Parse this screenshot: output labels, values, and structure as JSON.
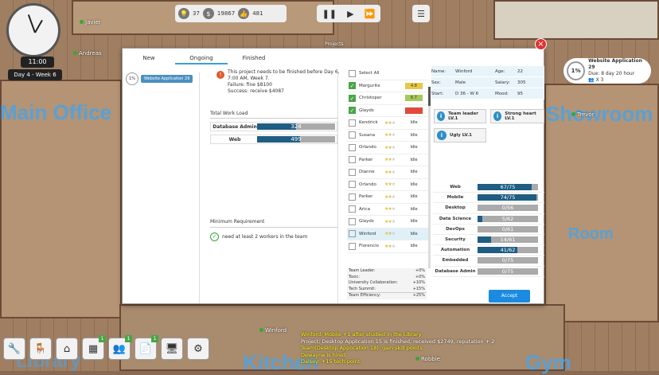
{
  "hud": {
    "time": "11:00",
    "day": "Day 4 - Week 6",
    "ideas": "37",
    "money": "19867",
    "reputation": "481",
    "projects_label": "Projects"
  },
  "rooms": {
    "main_office": "Main Office",
    "kitchen": "Kitchen",
    "gym": "Gym",
    "library": "Library",
    "showroom": "Showroom",
    "other_room": "Room"
  },
  "characters": [
    "Javier",
    "Andreas",
    "Winford",
    "Trevor",
    "Robbie",
    "Florencio"
  ],
  "dialog": {
    "tabs": [
      "New",
      "Ongoing",
      "Finished"
    ],
    "active_tab": "Ongoing",
    "project": {
      "pct": "1%",
      "name": "Website Application 29"
    },
    "info_lines": [
      "This project needs to be finished before Day 6,",
      "7:00 AM, Week 7.",
      "Failure: fine $8100",
      "Success: receive $4087"
    ],
    "workload_title": "Total Work Load",
    "workload": [
      {
        "label": "Database Admin",
        "value": "324",
        "frac": 0.7
      },
      {
        "label": "Web",
        "value": "499",
        "frac": 0.55
      }
    ],
    "min_req_title": "Minimum Requirement",
    "min_req": "need at least 2 workers in the team",
    "select_all": "Select All",
    "workers": [
      {
        "name": "Margurite",
        "checked": true,
        "stars": 0,
        "status": "4.8",
        "status_color": "#e8c84a"
      },
      {
        "name": "Christoper",
        "checked": true,
        "stars": 0,
        "status": "6.7",
        "status_color": "#a8c85a"
      },
      {
        "name": "Glayds",
        "checked": true,
        "stars": 0,
        "status": "",
        "status_color": "#e04a3a"
      },
      {
        "name": "Kendrick",
        "checked": false,
        "stars": 2,
        "status": "Idle",
        "status_color": ""
      },
      {
        "name": "Susana",
        "checked": false,
        "stars": 2,
        "status": "Idle",
        "status_color": ""
      },
      {
        "name": "Orlando",
        "checked": false,
        "stars": 2,
        "status": "Idle",
        "status_color": ""
      },
      {
        "name": "Parker",
        "checked": false,
        "stars": 2,
        "status": "Idle",
        "status_color": ""
      },
      {
        "name": "Dianne",
        "checked": false,
        "stars": 2,
        "status": "Idle",
        "status_color": ""
      },
      {
        "name": "Orlando",
        "checked": false,
        "stars": 2,
        "status": "Idle",
        "status_color": ""
      },
      {
        "name": "Parker",
        "checked": false,
        "stars": 2,
        "status": "Idle",
        "status_color": ""
      },
      {
        "name": "Arica",
        "checked": false,
        "stars": 2,
        "status": "Idle",
        "status_color": ""
      },
      {
        "name": "Glayds",
        "checked": false,
        "stars": 2,
        "status": "Idle",
        "status_color": ""
      },
      {
        "name": "Winford",
        "checked": false,
        "stars": 2,
        "status": "Idle",
        "status_color": "",
        "selected": true
      },
      {
        "name": "Florencio",
        "checked": false,
        "stars": 2,
        "status": "Idle",
        "status_color": ""
      }
    ],
    "efficiency": [
      {
        "label": "Team Leader:",
        "value": "+0%"
      },
      {
        "label": "Toxic:",
        "value": "+0%"
      },
      {
        "label": "University Collaboration:",
        "value": "+10%"
      },
      {
        "label": "Tech Summit:",
        "value": "+15%"
      },
      {
        "label": "Team Efficiency:",
        "value": "+25%"
      }
    ],
    "detail": {
      "name_label": "Name:",
      "name": "Winford",
      "age_label": "Age:",
      "age": "22",
      "sex_label": "Sex:",
      "sex": "Male",
      "salary_label": "Salary:",
      "salary": "305",
      "start_label": "Start:",
      "start": "D 36 - W 6",
      "mood_label": "Mood:",
      "mood": "95"
    },
    "traits": [
      "Team leader LV.1",
      "Strong heart LV.1",
      "Ugly LV.1"
    ],
    "skills": [
      {
        "label": "Web",
        "value": "67/75",
        "frac": 0.89
      },
      {
        "label": "Mobile",
        "value": "74/75",
        "frac": 0.98
      },
      {
        "label": "Desktop",
        "value": "0/56",
        "frac": 0.0
      },
      {
        "label": "Data Science",
        "value": "5/62",
        "frac": 0.08
      },
      {
        "label": "DevOps",
        "value": "0/61",
        "frac": 0.0
      },
      {
        "label": "Security",
        "value": "14/61",
        "frac": 0.23
      },
      {
        "label": "Automation",
        "value": "41/62",
        "frac": 0.66
      },
      {
        "label": "Embedded",
        "value": "0/75",
        "frac": 0.0
      },
      {
        "label": "Database Admin",
        "value": "0/75",
        "frac": 0.0
      }
    ],
    "accept": "Accept"
  },
  "right_card": {
    "pct": "1%",
    "title": "Website Application 29",
    "due": "Due: 8 day 20 hour",
    "people": "X 3"
  },
  "bottom_badges": [
    "1",
    "1",
    "1"
  ],
  "log": [
    {
      "text": "Winford: Mobile +1 after studied in the Library",
      "white": false
    },
    {
      "text": "Project: Desktop Application 15 is finished, received $2749, reputation + 2",
      "white": true
    },
    {
      "text": "Team(Desktop Application 18): gain skill points",
      "white": false
    },
    {
      "text": "Dewayne is hired.",
      "white": false
    },
    {
      "text": "Dalsey: +15 tech point",
      "white": false
    }
  ]
}
